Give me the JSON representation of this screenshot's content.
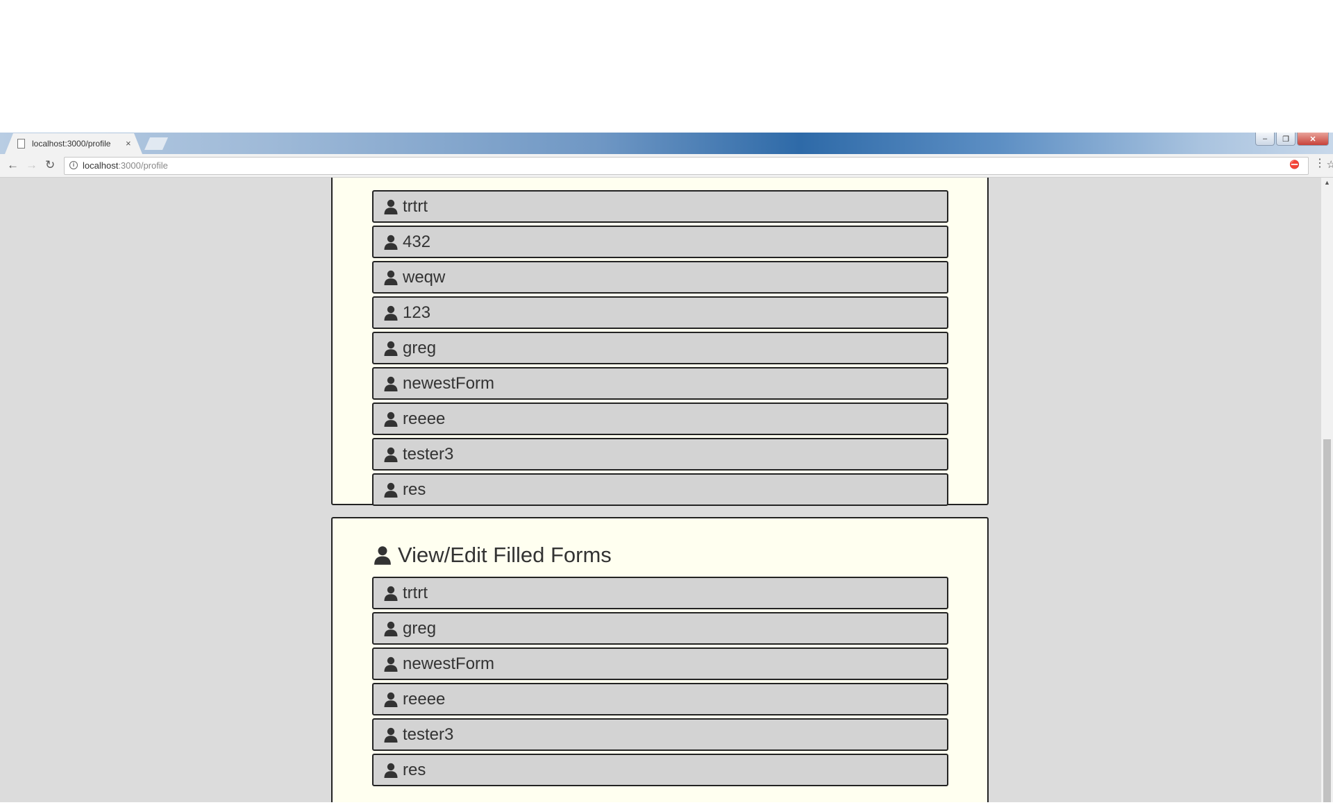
{
  "browser": {
    "tab_title": "localhost:3000/profile",
    "tab_close": "×",
    "window_buttons": {
      "minimize": "–",
      "restore": "❐",
      "close": "✕"
    },
    "nav": {
      "back": "←",
      "forward": "→",
      "reload": "↻"
    },
    "address": {
      "host": "localhost",
      "path": ":3000/profile"
    },
    "menu": "⋮",
    "bookmark": "☆",
    "scroll_up": "▲"
  },
  "forms_list": {
    "items": [
      "trtrt",
      "432",
      "weqw",
      "123",
      "greg",
      "newestForm",
      "reeee",
      "tester3",
      "res"
    ]
  },
  "filled_forms": {
    "heading": "View/Edit Filled Forms",
    "items": [
      "trtrt",
      "greg",
      "newestForm",
      "reeee",
      "tester3",
      "res"
    ]
  },
  "icons": {
    "item": "user-icon",
    "heading": "user-icon"
  },
  "colors": {
    "page_background": "#dcdcdc",
    "panel_background": "#fffff0",
    "item_background": "#d3d3d3",
    "border": "#222222",
    "text": "#333333"
  }
}
